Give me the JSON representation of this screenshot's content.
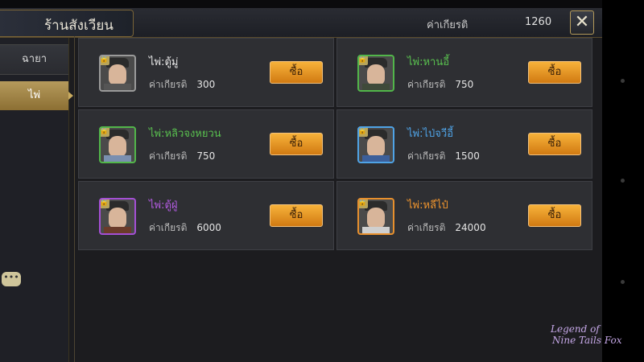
{
  "header": {
    "title": "ร้านสังเวียน",
    "prestige_label": "ค่าเกียรติ",
    "prestige_value": "1260",
    "close_symbol": "✕"
  },
  "sidebar": {
    "tabs": [
      {
        "label": "ฉายา",
        "active": false
      },
      {
        "label": "ไพ่",
        "active": true
      }
    ]
  },
  "chat": {
    "symbol": "•••"
  },
  "cards": [
    {
      "name": "ไพ่:ตู้มู่",
      "name_color": "#e6e6e6",
      "quality": "gray",
      "price_label": "ค่าเกียรติ",
      "price": "300",
      "buy_label": "ซื้อ"
    },
    {
      "name": "ไพ่:หานอี้",
      "name_color": "#59c04f",
      "quality": "green",
      "price_label": "ค่าเกียรติ",
      "price": "750",
      "buy_label": "ซื้อ"
    },
    {
      "name": "ไพ่:หลิวจงหยวน",
      "name_color": "#59c04f",
      "quality": "green",
      "price_label": "ค่าเกียรติ",
      "price": "750",
      "buy_label": "ซื้อ"
    },
    {
      "name": "ไพ่:ไป่จวีอี้",
      "name_color": "#4fa3e6",
      "quality": "blue",
      "price_label": "ค่าเกียรติ",
      "price": "1500",
      "buy_label": "ซื้อ"
    },
    {
      "name": "ไพ่:ตู้ฝู่",
      "name_color": "#b25be0",
      "quality": "purple",
      "price_label": "ค่าเกียรติ",
      "price": "6000",
      "buy_label": "ซื้อ"
    },
    {
      "name": "ไพ่:หลีไป๋",
      "name_color": "#f0952e",
      "quality": "orange",
      "price_label": "ค่าเกียรติ",
      "price": "24000",
      "buy_label": "ซื้อ"
    }
  ],
  "logo": {
    "line1": "Legend of",
    "line2": "Nine Tails Fox"
  }
}
